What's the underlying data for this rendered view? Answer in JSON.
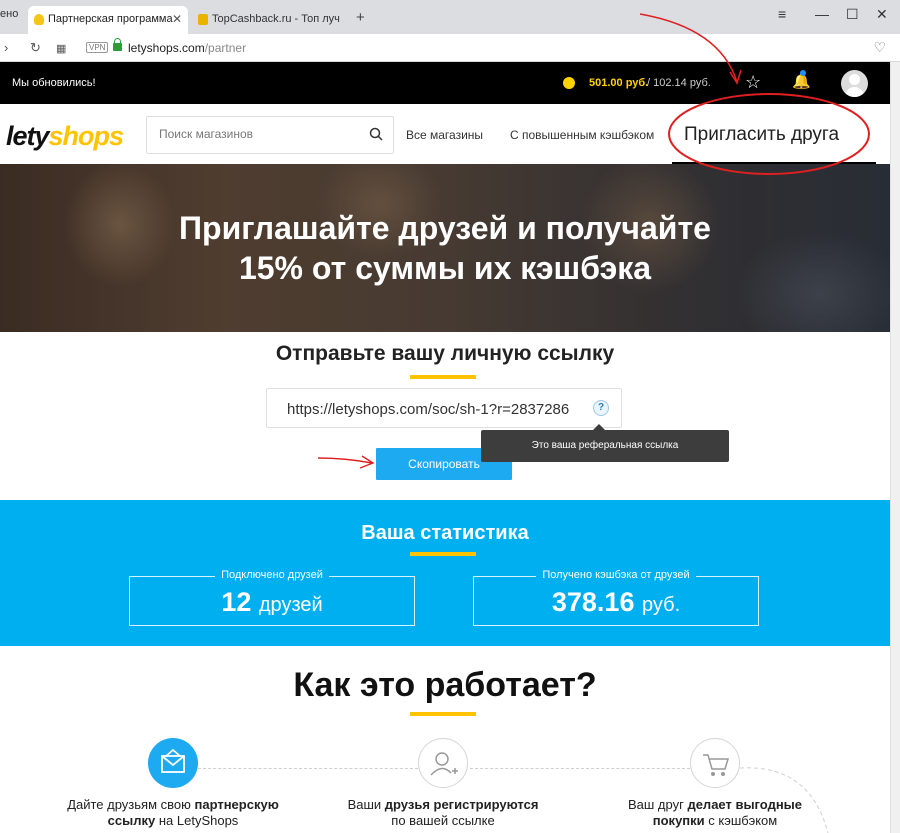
{
  "browser": {
    "tab_fragment": "ено",
    "tabs": [
      {
        "title": "Партнерская программа",
        "active": true
      },
      {
        "title": "TopCashback.ru - Топ луч",
        "active": false
      }
    ],
    "newtab_label": "+",
    "address": {
      "vpn_label": "VPN",
      "host": "letyshops.com",
      "path": "/partner"
    }
  },
  "topbar": {
    "updated_text": "Мы обновились!",
    "balance_primary": "501.00 руб.",
    "balance_separator": "/",
    "balance_secondary": "102.14 руб."
  },
  "header": {
    "logo_part1": "lety",
    "logo_part2": "shops",
    "search_placeholder": "Поиск магазинов",
    "nav": [
      {
        "label": "Все магазины"
      },
      {
        "label": "С повышенным кэшбэком"
      },
      {
        "label": "Пригласить друга"
      }
    ]
  },
  "hero": {
    "line1": "Приглашайте друзей и получайте",
    "line2": "15% от суммы их кэшбэка"
  },
  "referral": {
    "title": "Отправьте вашу личную ссылку",
    "link": "https://letyshops.com/soc/sh-1?r=2837286",
    "help": "?",
    "tooltip": "Это ваша реферальная ссылка",
    "copy_button": "Скопировать"
  },
  "stats": {
    "title": "Ваша статистика",
    "friends": {
      "label": "Подключено друзей",
      "value": "12",
      "unit": "друзей"
    },
    "cashback": {
      "label": "Получено кэшбэка от друзей",
      "value": "378.16",
      "unit": "руб."
    }
  },
  "how": {
    "title": "Как это работает?",
    "steps": [
      {
        "line1_a": "Дайте друзьям свою ",
        "line1_b": "партнерскую",
        "line2_a": "ссылку",
        "line2_b": " на LetyShops",
        "icon": "envelope-icon"
      },
      {
        "line1_a": "Ваши ",
        "line1_b": "друзья регистрируются",
        "line2_a": "",
        "line2_b": "по вашей ссылке",
        "icon": "add-user-icon"
      },
      {
        "line1_a": "Ваш друг ",
        "line1_b": "делает выгодные",
        "line2_a": "покупки",
        "line2_b": " с кэшбэком",
        "icon": "cart-icon"
      }
    ]
  },
  "colors": {
    "accent_yellow": "#ffc300",
    "accent_blue": "#00aff0",
    "annotation_red": "#e02020"
  }
}
